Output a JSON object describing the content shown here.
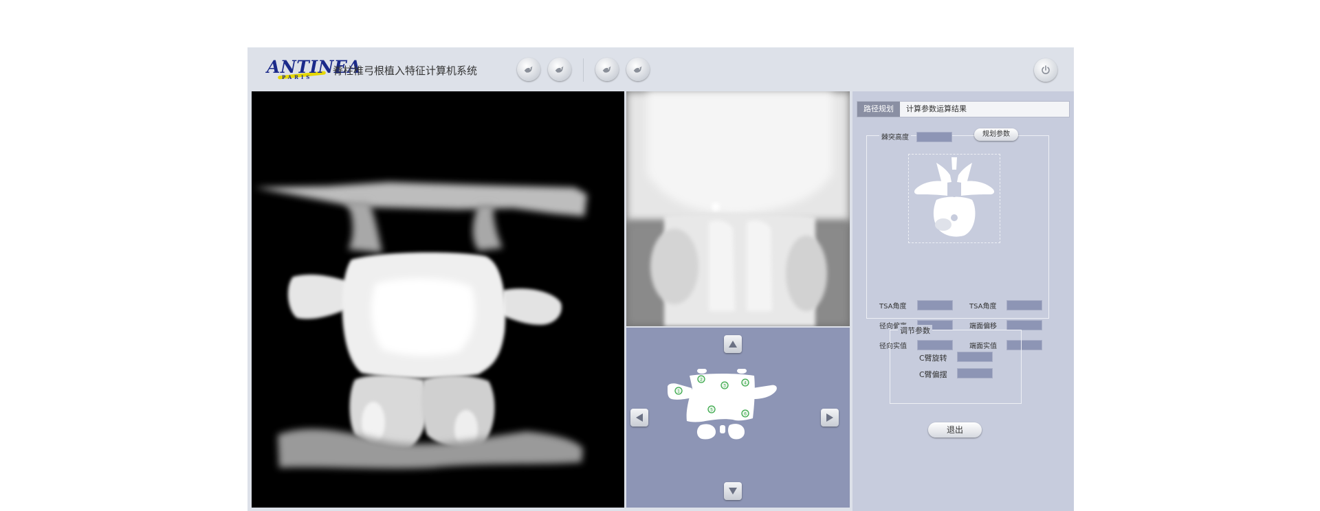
{
  "header": {
    "logo_text": "ANTINEA",
    "logo_sub": "PARIS",
    "title": "脊柱椎弓根植入特征计算机系统",
    "toolbar_icons": [
      "bird-icon",
      "bird-icon",
      "bird-icon",
      "bird-icon"
    ],
    "power_icon": "power-icon"
  },
  "nav_icons": {
    "up": "triangle-up-icon",
    "down": "triangle-down-icon",
    "left": "triangle-left-icon",
    "right": "triangle-right-icon"
  },
  "nav_markers": [
    "1",
    "2",
    "3",
    "4",
    "5",
    "6"
  ],
  "panel": {
    "tab_active": "路径规划",
    "tab_label": "计算参数运算结果",
    "spinous_height_label": "棘突高度",
    "plan_params_button": "规划参数",
    "left_params": [
      {
        "label": "TSA角度"
      },
      {
        "label": "径向偏离"
      },
      {
        "label": "径向实值"
      }
    ],
    "right_params": [
      {
        "label": "TSA角度"
      },
      {
        "label": "端面偏移"
      },
      {
        "label": "端面实值"
      }
    ],
    "adjust_title": "调节参数",
    "adjust_params": [
      {
        "label": "C臂旋转"
      },
      {
        "label": "C臂偏摆"
      }
    ],
    "exit_button": "退出"
  },
  "colors": {
    "frame": "#dde1e9",
    "panel": "#c7ccdd",
    "value_box": "#8d95b5",
    "nav_background": "#8d95b5",
    "marker_green": "#3aa84a"
  }
}
